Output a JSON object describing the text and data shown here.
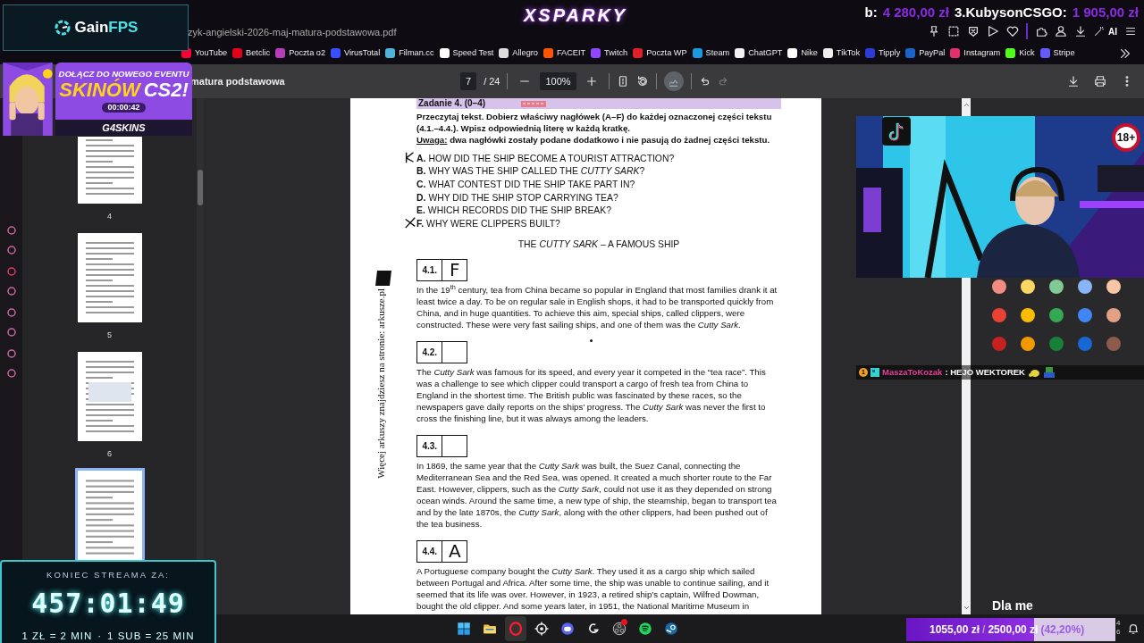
{
  "browser": {
    "address": "zyk-angielski-2026-maj-matura-podstawowa.pdf",
    "ai_label": "AI"
  },
  "bookmarks": [
    {
      "label": "YouTube",
      "color": "#ff0033"
    },
    {
      "label": "Betclic",
      "color": "#e3001b"
    },
    {
      "label": "Poczta o2",
      "color": "#b83dba"
    },
    {
      "label": "VirusTotal",
      "color": "#394eff"
    },
    {
      "label": "Filman.cc",
      "color": "#4fb3d9"
    },
    {
      "label": "Speed Test",
      "color": "#ffffff"
    },
    {
      "label": "Allegro",
      "color": "#dddddd"
    },
    {
      "label": "FACEIT",
      "color": "#ff5500"
    },
    {
      "label": "Twitch",
      "color": "#9146ff"
    },
    {
      "label": "Poczta WP",
      "color": "#e0202a"
    },
    {
      "label": "Steam",
      "color": "#1b9ae0"
    },
    {
      "label": "ChatGPT",
      "color": "#f2f2f2"
    },
    {
      "label": "Nike",
      "color": "#ffffff"
    },
    {
      "label": "TikTok",
      "color": "#eeeeee"
    },
    {
      "label": "Tipply",
      "color": "#2d3bd6"
    },
    {
      "label": "PayPal",
      "color": "#1a64c8"
    },
    {
      "label": "Instagram",
      "color": "#e1306c"
    },
    {
      "label": "Kick",
      "color": "#53fc18"
    },
    {
      "label": "Stripe",
      "color": "#635bff"
    }
  ],
  "pdf_toolbar": {
    "title": "matura podstawowa",
    "page": "7",
    "page_count": "/ 24",
    "zoom": "100%",
    "annotate_selected": true,
    "redo_disabled": true
  },
  "thumbnails": [
    {
      "label": "4",
      "selected": false
    },
    {
      "label": "5",
      "selected": false
    },
    {
      "label": "6",
      "selected": false
    },
    {
      "selected": true
    }
  ],
  "document": {
    "task": "Zadanie 4. (0–4)",
    "instructions": "Przeczytaj tekst. Dobierz właściwy nagłówek (A–F) do każdej oznaczonej części tekstu (4.1.–4.4.). Wpisz odpowiednią literę w każdą kratkę.",
    "note_label": "Uwaga:",
    "note": "dwa nagłówki zostały podane dodatkowo i nie pasują do żadnej części tekstu.",
    "options": [
      {
        "letter": "A.",
        "text": "HOW DID THE SHIP BECOME A TOURIST ATTRACTION?",
        "kind": "ticked"
      },
      {
        "letter": "B.",
        "text": "WHY WAS THE SHIP CALLED THE *CUTTY SARK*?",
        "kind": "plain"
      },
      {
        "letter": "C.",
        "text": "WHAT CONTEST DID THE SHIP TAKE PART IN?",
        "kind": "plain"
      },
      {
        "letter": "D.",
        "text": "WHY DID THE SHIP STOP CARRYING TEA?",
        "kind": "plain"
      },
      {
        "letter": "E.",
        "text": "WHICH RECORDS DID THE SHIP BREAK?",
        "kind": "plain"
      },
      {
        "letter": "F.",
        "text": "WHY WERE CLIPPERS BUILT?",
        "kind": "crossed"
      }
    ],
    "title": "THE *CUTTY SARK* – A FAMOUS SHIP",
    "sections": [
      {
        "number": "4.1.",
        "answer": "F",
        "text": "In the 19$^{th}$ century, tea from China became so popular in England that most families drank it at least twice a day. To be on regular sale in English shops, it had to be transported quickly from China, and in huge quantities. To achieve this aim, special ships, called clippers, were constructed. These were very fast sailing ships, and one of them was the *Cutty Sark*."
      },
      {
        "number": "4.2.",
        "text": "The *Cutty Sark* was famous for its speed, and every year it competed in the “tea race”. This was a challenge to see which clipper could transport a cargo of fresh tea from China to England in the shortest time. The British public was fascinated by these races, so the newspapers gave daily reports on the ships’ progress. The *Cutty Sark* was never the first to cross the finishing line, but it was always among the leaders."
      },
      {
        "number": "4.3.",
        "text": "In 1869, the same year that the *Cutty Sark* was built, the Suez Canal, connecting the Mediterranean Sea and the Red Sea, was opened. It created a much shorter route to the Far East. However, clippers, such as the *Cutty Sark*, could not use it as they depended on strong ocean winds. Around the same time, a new type of ship, the steamship, began to transport tea and by the late 1870s, the *Cutty Sark*, along with the other clippers, had been pushed out of the tea business."
      },
      {
        "number": "4.4.",
        "answer": "A",
        "text": "A Portuguese company bought the *Cutty Sark*. They used it as a cargo ship which sailed between Portugal and Africa. After some time, the ship was unable to continue sailing, and it seemed that its life was over. However, in 1923, a retired ship’s captain, Wilfred Dowman, bought the old clipper. And some years later, in 1951, the National Maritime Museum in"
      }
    ],
    "side_text": "Więcej arkuszy znajdziesz na stronie: arkusze.pl"
  },
  "overlays": {
    "brand": "XSPARKY",
    "ticker": [
      {
        "text": "b:",
        "kind": "name"
      },
      {
        "text": "4 280,00 zł",
        "kind": "amount"
      },
      {
        "text": "3.KubysonCSGO:",
        "kind": "name"
      },
      {
        "text": "1 905,00 zł",
        "kind": "amount"
      }
    ],
    "sponsor": [
      "Gain",
      "FPS"
    ],
    "ad": {
      "headline": "DOŁĄCZ DO NOWEGO EVENTU",
      "big": [
        "SKINÓW",
        "CS2!"
      ],
      "countdown": "00:00:42",
      "brand": "G4SKINS"
    },
    "timer": {
      "title": "KONIEC STREAMA ZA:",
      "time": "457:01:49",
      "rates": [
        "1 ZŁ = 2 MIN",
        "·",
        "1 SUB = 25 MIN"
      ]
    },
    "webcam": {
      "badge": "18+"
    },
    "chat": {
      "badge": "1",
      "user": "MaszaToKozak",
      "message": ": HEJO WEKTOREK"
    },
    "caption": "Dla me",
    "goal": {
      "current": "1055,00 zł",
      "separator": "/",
      "target": "2500,00 zł",
      "percent": "(42,20%)",
      "level": 0.61
    }
  },
  "palette": [
    {
      "color": "#f28b82"
    },
    {
      "color": "#fdd663"
    },
    {
      "color": "#81c995"
    },
    {
      "color": "#8ab4f8"
    },
    {
      "color": "#f6c6a6"
    },
    {
      "color": "#e94235"
    },
    {
      "color": "#fbbc04"
    },
    {
      "color": "#34a853"
    },
    {
      "color": "#4285f4"
    },
    {
      "color": "#e2a084"
    },
    {
      "color": "#c5221f"
    },
    {
      "color": "#f29900"
    },
    {
      "color": "#188038"
    },
    {
      "color": "#1967d2"
    },
    {
      "color": "#8d5b4b"
    }
  ],
  "taskbar": [
    {
      "kind": "windows",
      "selected": false,
      "notification": false
    },
    {
      "kind": "folder",
      "selected": false,
      "notification": false
    },
    {
      "kind": "opera",
      "selected": true,
      "notification": false
    },
    {
      "kind": "gear",
      "selected": false,
      "notification": false
    },
    {
      "kind": "discord",
      "selected": false,
      "notification": false
    },
    {
      "kind": "logitech",
      "selected": false,
      "notification": false
    },
    {
      "kind": "obs",
      "selected": false,
      "notification": true
    },
    {
      "kind": "spotify",
      "selected": false,
      "notification": false
    },
    {
      "kind": "steam",
      "selected": false,
      "notification": false
    }
  ],
  "clock": [
    "4",
    "6"
  ]
}
